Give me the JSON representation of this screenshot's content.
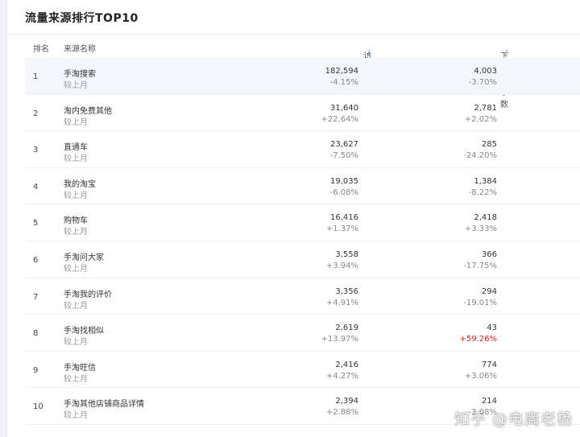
{
  "title": "流量来源排行TOP10",
  "headers": {
    "rank": "排名",
    "name": "来源名称",
    "visitors": "访客数",
    "buyers": "下单买家数"
  },
  "icons": {
    "visitors_sort": "sort-down-icon",
    "buyers_sort": "sort-updown-icon"
  },
  "colors": {
    "accent": "#3a8ee6",
    "increase_highlight": "#e02020"
  },
  "rows": [
    {
      "rank": "1",
      "name": "手淘搜索",
      "compare": "较上月",
      "visitors": "182,594",
      "visitors_change": "-4.15%",
      "buyers": "4,003",
      "buyers_change": "-3.70%"
    },
    {
      "rank": "2",
      "name": "淘内免费其他",
      "compare": "较上月",
      "visitors": "31,640",
      "visitors_change": "+22.64%",
      "buyers": "2,781",
      "buyers_change": "+2.02%"
    },
    {
      "rank": "3",
      "name": "直通车",
      "compare": "较上月",
      "visitors": "23,627",
      "visitors_change": "-7.50%",
      "buyers": "285",
      "buyers_change": "-24.20%"
    },
    {
      "rank": "4",
      "name": "我的淘宝",
      "compare": "较上月",
      "visitors": "19,035",
      "visitors_change": "-6.08%",
      "buyers": "1,384",
      "buyers_change": "-8.22%"
    },
    {
      "rank": "5",
      "name": "购物车",
      "compare": "较上月",
      "visitors": "16,416",
      "visitors_change": "+1.37%",
      "buyers": "2,418",
      "buyers_change": "+3.33%"
    },
    {
      "rank": "6",
      "name": "手淘问大家",
      "compare": "较上月",
      "visitors": "3,558",
      "visitors_change": "+3.94%",
      "buyers": "366",
      "buyers_change": "-17.75%"
    },
    {
      "rank": "7",
      "name": "手淘我的评价",
      "compare": "较上月",
      "visitors": "3,356",
      "visitors_change": "+4.91%",
      "buyers": "294",
      "buyers_change": "-19.01%"
    },
    {
      "rank": "8",
      "name": "手淘找相似",
      "compare": "较上月",
      "visitors": "2,619",
      "visitors_change": "+13.97%",
      "buyers": "43",
      "buyers_change": "+59.26%"
    },
    {
      "rank": "9",
      "name": "手淘旺信",
      "compare": "较上月",
      "visitors": "2,416",
      "visitors_change": "+4.27%",
      "buyers": "774",
      "buyers_change": "+3.06%"
    },
    {
      "rank": "10",
      "name": "手淘其他店铺商品详情",
      "compare": "较上月",
      "visitors": "2,394",
      "visitors_change": "+2.88%",
      "buyers": "214",
      "buyers_change": "-3.08%"
    }
  ],
  "watermark": "知乎 @电商老杨"
}
